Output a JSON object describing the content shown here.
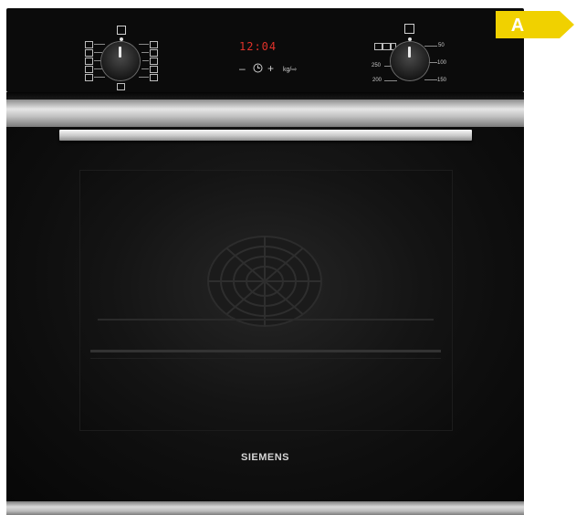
{
  "brand": "SIEMENS",
  "energy_class": {
    "label": "A",
    "color": "#f0d100"
  },
  "display": {
    "time": "12:04"
  },
  "controls": {
    "minus": "–",
    "plus": "+",
    "weight": "kg/⇨"
  },
  "temperature_scale": {
    "left": [
      "250",
      "200"
    ],
    "right": [
      "50",
      "100",
      "150"
    ]
  },
  "icons": {
    "mode_knob": "oven-mode-knob",
    "temp_knob": "temperature-knob",
    "light": "light-icon",
    "clock": "clock-icon"
  },
  "colors": {
    "display": "#e0322a",
    "steel": "#c8c8c8",
    "body": "#0b0b0b"
  }
}
